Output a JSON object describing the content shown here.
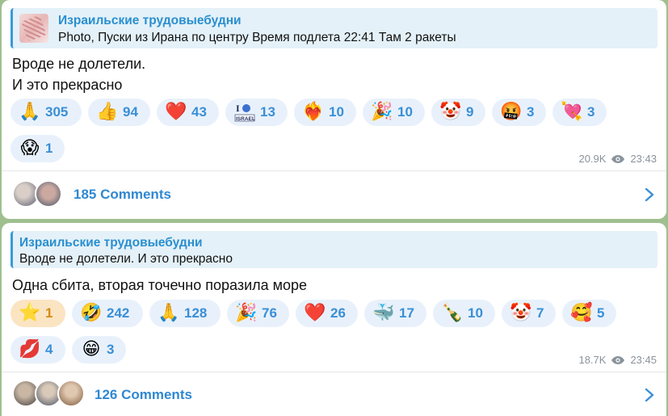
{
  "messages": [
    {
      "reply": {
        "title": "Израильские трудовыебудни",
        "text": "Photo, Пуски из Ирана по центру Время подлета 22:41 Там 2 ракеты"
      },
      "body": [
        "Вроде не долетели.",
        "И это прекрасно"
      ],
      "reactions": [
        {
          "icon": "praying-hands",
          "glyph": "🙏",
          "count": "305"
        },
        {
          "icon": "thumbs-up",
          "glyph": "👍",
          "count": "94"
        },
        {
          "icon": "red-heart",
          "glyph": "❤️",
          "count": "43"
        },
        {
          "icon": "i-love-israel-sticker",
          "glyph": "I♥",
          "count": "13"
        },
        {
          "icon": "heart-on-fire",
          "glyph": "❤️‍🔥",
          "count": "10"
        },
        {
          "icon": "party-popper",
          "glyph": "🎉",
          "count": "10"
        },
        {
          "icon": "clown-face",
          "glyph": "🤡",
          "count": "9"
        },
        {
          "icon": "face-with-symbols",
          "glyph": "🤬",
          "count": "3"
        },
        {
          "icon": "heart-with-arrow",
          "glyph": "💘",
          "count": "3"
        },
        {
          "icon": "face-screaming",
          "glyph": "😱",
          "count": "1"
        }
      ],
      "views": "20.9K",
      "time": "23:43",
      "comments": "185 Comments"
    },
    {
      "reply": {
        "title": "Израильские трудовыебудни",
        "text": "Вроде не долетели. И это прекрасно"
      },
      "body": [
        "Одна сбита, вторая точечно поразила море"
      ],
      "reactions": [
        {
          "icon": "star",
          "glyph": "⭐",
          "count": "1",
          "selected": true
        },
        {
          "icon": "rolling-laughing-face",
          "glyph": "🤣",
          "count": "242"
        },
        {
          "icon": "praying-hands",
          "glyph": "🙏",
          "count": "128"
        },
        {
          "icon": "party-popper",
          "glyph": "🎉",
          "count": "76"
        },
        {
          "icon": "red-heart",
          "glyph": "❤️",
          "count": "26"
        },
        {
          "icon": "whale",
          "glyph": "🐳",
          "count": "17"
        },
        {
          "icon": "champagne-bottle",
          "glyph": "🍾",
          "count": "10"
        },
        {
          "icon": "clown-face",
          "glyph": "🤡",
          "count": "7"
        },
        {
          "icon": "smiling-face-with-hearts",
          "glyph": "🥰",
          "count": "5"
        },
        {
          "icon": "kiss-mark",
          "glyph": "💋",
          "count": "4"
        },
        {
          "icon": "grinning-face",
          "glyph": "😁",
          "count": "3"
        }
      ],
      "views": "18.7K",
      "time": "23:45",
      "comments": "126 Comments"
    }
  ],
  "colors": {
    "accent": "#2f88d2",
    "reaction_bg": "#e8f1fb",
    "selected_reaction_bg": "#fbe4c2",
    "chat_bg": "#9fbf8f"
  }
}
